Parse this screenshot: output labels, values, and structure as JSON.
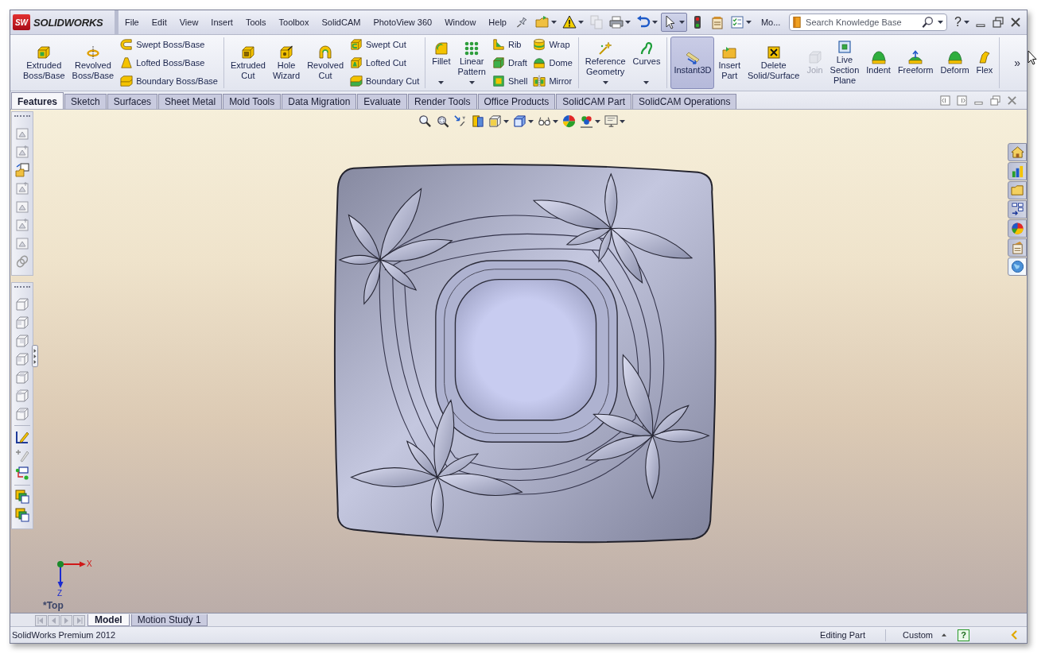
{
  "title_bar": {
    "logo_mark": "SW",
    "logo": "SOLIDWORKS",
    "menu": [
      "File",
      "Edit",
      "View",
      "Insert",
      "Tools",
      "Toolbox",
      "SolidCAM",
      "PhotoView 360",
      "Window",
      "Help"
    ],
    "quick_access": [
      {
        "dropdown": true,
        "disabled": false,
        "pressed": false
      },
      {
        "dropdown": true,
        "disabled": false,
        "pressed": false
      },
      {
        "dropdown": false,
        "disabled": true,
        "pressed": false
      },
      {
        "dropdown": true,
        "disabled": false,
        "pressed": false
      },
      {
        "dropdown": true,
        "disabled": false,
        "pressed": false
      },
      {
        "dropdown": true,
        "disabled": false,
        "pressed": true
      },
      {
        "dropdown": false,
        "disabled": false,
        "pressed": false
      },
      {
        "dropdown": false,
        "disabled": false,
        "pressed": false
      },
      {
        "dropdown": true,
        "disabled": false,
        "pressed": false
      }
    ],
    "more": "Mo...",
    "search": {
      "placeholder": "Search Knowledge Base"
    },
    "help": "?"
  },
  "ribbon": {
    "groups": [
      {
        "tools": [
          {
            "label": "Extruded Boss/Base",
            "kind": "large"
          },
          {
            "label": "Revolved Boss/Base",
            "kind": "large"
          },
          {
            "label": "Swept Boss/Base",
            "kind": "small"
          },
          {
            "label": "Lofted Boss/Base",
            "kind": "small"
          },
          {
            "label": "Boundary Boss/Base",
            "kind": "small"
          }
        ]
      },
      {
        "tools": [
          {
            "label": "Extruded Cut",
            "kind": "large"
          },
          {
            "label": "Hole Wizard",
            "kind": "large"
          },
          {
            "label": "Revolved Cut",
            "kind": "large"
          },
          {
            "label": "Swept Cut",
            "kind": "small"
          },
          {
            "label": "Lofted Cut",
            "kind": "small"
          },
          {
            "label": "Boundary Cut",
            "kind": "small"
          }
        ]
      },
      {
        "tools": [
          {
            "label": "Fillet",
            "kind": "large",
            "dropdown": true
          },
          {
            "label": "Linear Pattern",
            "kind": "large",
            "dropdown": true
          },
          {
            "label": "Rib",
            "kind": "small",
            "dropdown": false
          },
          {
            "label": "Draft",
            "kind": "small",
            "dropdown": false
          },
          {
            "label": "Shell",
            "kind": "small",
            "dropdown": false
          },
          {
            "label": "Wrap",
            "kind": "small",
            "dropdown": false
          },
          {
            "label": "Dome",
            "kind": "small",
            "dropdown": false
          },
          {
            "label": "Mirror",
            "kind": "small",
            "dropdown": false
          }
        ]
      },
      {
        "tools": [
          {
            "label": "Reference Geometry",
            "kind": "large",
            "dropdown": true
          },
          {
            "label": "Curves",
            "kind": "large",
            "dropdown": true
          }
        ]
      },
      {
        "tools": [
          {
            "label": "Instant3D",
            "kind": "large",
            "pressed": true,
            "disabled": false
          },
          {
            "label": "Insert Part",
            "kind": "large",
            "pressed": false,
            "disabled": false
          },
          {
            "label": "Delete Solid/Surface",
            "kind": "large",
            "pressed": false,
            "disabled": false
          },
          {
            "label": "Join",
            "kind": "large",
            "pressed": false,
            "disabled": true
          },
          {
            "label": "Live Section Plane",
            "kind": "large",
            "pressed": false,
            "disabled": false
          },
          {
            "label": "Indent",
            "kind": "large",
            "pressed": false,
            "disabled": false
          },
          {
            "label": "Freeform",
            "kind": "large",
            "pressed": false,
            "disabled": false
          },
          {
            "label": "Deform",
            "kind": "large",
            "pressed": false,
            "disabled": false
          },
          {
            "label": "Flex",
            "kind": "large",
            "pressed": false,
            "disabled": false
          }
        ]
      }
    ],
    "overflow": "»"
  },
  "command_tabs": [
    {
      "label": "Features",
      "selected": true
    },
    {
      "label": "Sketch",
      "selected": false
    },
    {
      "label": "Surfaces",
      "selected": false
    },
    {
      "label": "Sheet Metal",
      "selected": false
    },
    {
      "label": "Mold Tools",
      "selected": false
    },
    {
      "label": "Data Migration",
      "selected": false
    },
    {
      "label": "Evaluate",
      "selected": false
    },
    {
      "label": "Render Tools",
      "selected": false
    },
    {
      "label": "Office Products",
      "selected": false
    },
    {
      "label": "SolidCAM Part",
      "selected": false
    },
    {
      "label": "SolidCAM Operations",
      "selected": false
    }
  ],
  "task_pane_tabs": [
    {
      "selected": false
    },
    {
      "selected": false
    },
    {
      "selected": false
    },
    {
      "selected": false
    },
    {
      "selected": false
    },
    {
      "selected": false
    },
    {
      "selected": true
    }
  ],
  "viewport": {
    "triad": {
      "x_label": "X",
      "z_label": "Z"
    },
    "view_name": "*Top"
  },
  "model_tabs": [
    {
      "label": "Model",
      "selected": true
    },
    {
      "label": "Motion Study 1",
      "selected": false
    }
  ],
  "status_bar": {
    "product": "SolidWorks Premium 2012",
    "mode": "Editing Part",
    "units": "Custom",
    "help": "?"
  }
}
